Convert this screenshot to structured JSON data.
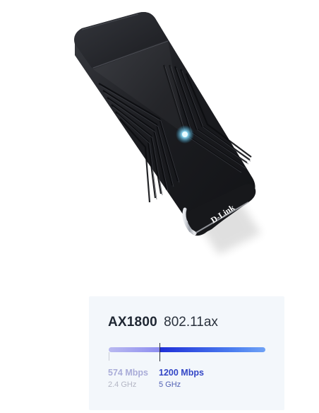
{
  "product": {
    "brand_logo": "D-Link",
    "image_description": "USB Wi-Fi adapter"
  },
  "spec": {
    "model": "AX1800",
    "standard": "802.11ax",
    "bands": [
      {
        "speed": "574 Mbps",
        "frequency": "2.4 GHz",
        "rate_mbps": 574,
        "color": "#9a9af0"
      },
      {
        "speed": "1200 Mbps",
        "frequency": "5 GHz",
        "rate_mbps": 1200,
        "color": "#2f4fe0"
      }
    ]
  },
  "colors": {
    "card_background": "#f3f7fb",
    "accent_blue": "#3346c6",
    "accent_light": "#a9acd8",
    "device_body": "#1c1d21",
    "led_glow": "#9fe8ff"
  }
}
